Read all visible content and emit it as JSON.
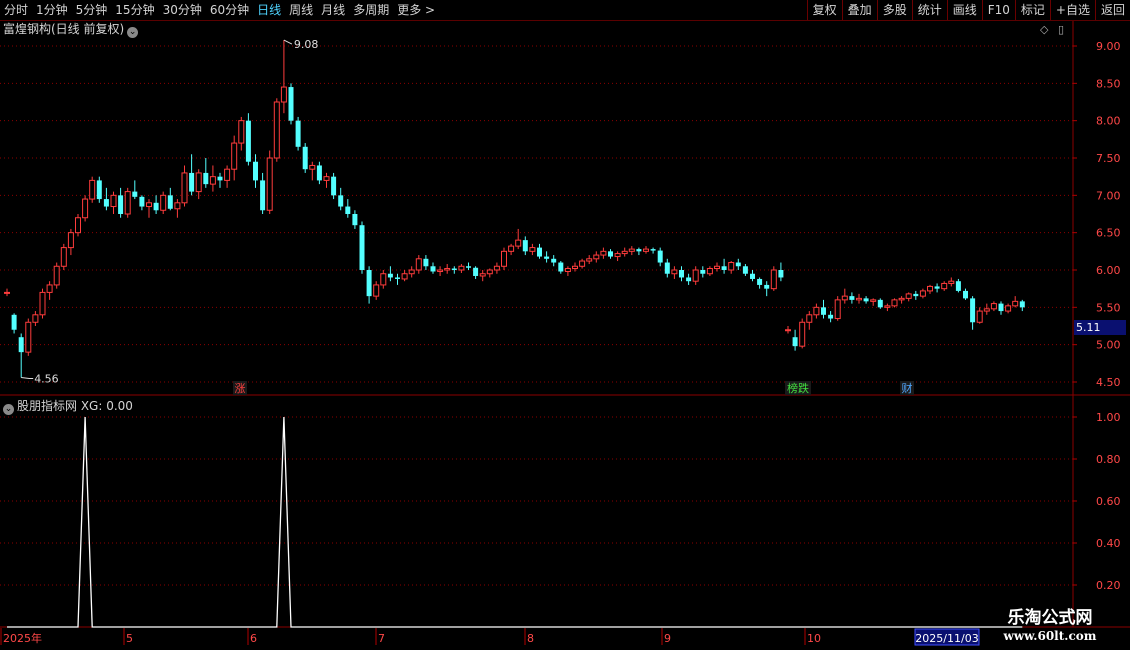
{
  "toolbar": {
    "periods": [
      "分时",
      "1分钟",
      "5分钟",
      "15分钟",
      "30分钟",
      "60分钟",
      "日线",
      "周线",
      "月线",
      "多周期",
      "更多 >"
    ],
    "active_period": "日线",
    "actions": [
      "复权",
      "叠加",
      "多股",
      "统计",
      "画线",
      "F10",
      "标记",
      "+自选",
      "返回"
    ]
  },
  "main": {
    "title": "富煌钢构(日线 前复权)",
    "high_label": "9.08",
    "low_label": "4.56",
    "current_price": "5.11",
    "y_ticks": [
      "9.00",
      "8.50",
      "8.00",
      "7.50",
      "7.00",
      "6.50",
      "6.00",
      "5.50",
      "5.00",
      "4.50"
    ],
    "markers": [
      {
        "text": "涨",
        "color": "#ff4040"
      },
      {
        "text": "榜跌",
        "color": "#40e040"
      },
      {
        "text": "财",
        "color": "#4fa8ff"
      }
    ]
  },
  "indicator": {
    "title": "股朋指标网 XG: 0.00",
    "y_ticks": [
      "1.00",
      "0.80",
      "0.60",
      "0.40",
      "0.20"
    ]
  },
  "x_axis": {
    "labels": [
      "2025年",
      "5",
      "6",
      "7",
      "8",
      "9",
      "10"
    ],
    "date_box": "2025/11/03"
  },
  "watermark": {
    "line1": "乐淘公式网",
    "line2": "www.60lt.com"
  },
  "colors": {
    "up": "#ff3c3c",
    "down": "#54ffff",
    "grid": "#8b0000",
    "line": "#ffffff"
  },
  "chart_data": [
    {
      "type": "candlestick",
      "title": "富煌钢构(日线 前复权)",
      "ylim": [
        4.4,
        9.2
      ],
      "high": 9.08,
      "low": 4.56,
      "last": 5.11,
      "ohlc": [
        [
          5.7,
          5.75,
          5.65,
          5.7
        ],
        [
          5.4,
          5.42,
          5.15,
          5.2
        ],
        [
          5.1,
          5.15,
          4.56,
          4.9
        ],
        [
          4.9,
          5.35,
          4.85,
          5.3
        ],
        [
          5.3,
          5.45,
          5.25,
          5.4
        ],
        [
          5.4,
          5.75,
          5.35,
          5.7
        ],
        [
          5.7,
          5.85,
          5.6,
          5.8
        ],
        [
          5.8,
          6.1,
          5.75,
          6.05
        ],
        [
          6.05,
          6.35,
          6.0,
          6.3
        ],
        [
          6.3,
          6.55,
          6.2,
          6.5
        ],
        [
          6.5,
          6.75,
          6.45,
          6.7
        ],
        [
          6.7,
          7.0,
          6.65,
          6.95
        ],
        [
          6.95,
          7.25,
          6.9,
          7.2
        ],
        [
          7.2,
          7.25,
          6.9,
          6.95
        ],
        [
          6.95,
          7.1,
          6.8,
          6.85
        ],
        [
          6.85,
          7.05,
          6.75,
          7.0
        ],
        [
          7.0,
          7.1,
          6.7,
          6.75
        ],
        [
          6.75,
          7.1,
          6.7,
          7.05
        ],
        [
          7.05,
          7.2,
          6.95,
          6.98
        ],
        [
          6.98,
          7.0,
          6.8,
          6.85
        ],
        [
          6.85,
          6.95,
          6.7,
          6.9
        ],
        [
          6.9,
          7.0,
          6.75,
          6.8
        ],
        [
          6.8,
          7.05,
          6.75,
          7.0
        ],
        [
          7.0,
          7.1,
          6.8,
          6.82
        ],
        [
          6.82,
          6.95,
          6.7,
          6.9
        ],
        [
          6.9,
          7.4,
          6.85,
          7.3
        ],
        [
          7.3,
          7.55,
          7.0,
          7.05
        ],
        [
          7.05,
          7.35,
          6.95,
          7.3
        ],
        [
          7.3,
          7.5,
          7.1,
          7.15
        ],
        [
          7.15,
          7.4,
          7.05,
          7.25
        ],
        [
          7.25,
          7.3,
          7.1,
          7.2
        ],
        [
          7.2,
          7.4,
          7.1,
          7.35
        ],
        [
          7.35,
          7.8,
          7.2,
          7.7
        ],
        [
          7.7,
          8.05,
          7.6,
          8.0
        ],
        [
          8.0,
          8.1,
          7.4,
          7.45
        ],
        [
          7.45,
          7.55,
          7.1,
          7.2
        ],
        [
          7.2,
          7.3,
          6.75,
          6.8
        ],
        [
          6.8,
          7.6,
          6.75,
          7.5
        ],
        [
          7.5,
          8.3,
          7.45,
          8.25
        ],
        [
          8.25,
          9.08,
          8.1,
          8.45
        ],
        [
          8.45,
          8.5,
          7.95,
          8.0
        ],
        [
          8.0,
          8.05,
          7.6,
          7.65
        ],
        [
          7.65,
          7.7,
          7.3,
          7.35
        ],
        [
          7.35,
          7.45,
          7.2,
          7.4
        ],
        [
          7.4,
          7.45,
          7.15,
          7.2
        ],
        [
          7.2,
          7.3,
          7.1,
          7.25
        ],
        [
          7.25,
          7.3,
          6.95,
          7.0
        ],
        [
          7.0,
          7.1,
          6.8,
          6.85
        ],
        [
          6.85,
          6.95,
          6.7,
          6.75
        ],
        [
          6.75,
          6.8,
          6.55,
          6.6
        ],
        [
          6.6,
          6.65,
          5.95,
          6.0
        ],
        [
          6.0,
          6.05,
          5.55,
          5.65
        ],
        [
          5.65,
          5.85,
          5.6,
          5.8
        ],
        [
          5.8,
          6.0,
          5.75,
          5.95
        ],
        [
          5.95,
          6.05,
          5.85,
          5.9
        ],
        [
          5.9,
          5.95,
          5.8,
          5.88
        ],
        [
          5.88,
          6.0,
          5.85,
          5.95
        ],
        [
          5.95,
          6.05,
          5.9,
          6.0
        ],
        [
          6.0,
          6.2,
          5.95,
          6.15
        ],
        [
          6.15,
          6.2,
          6.0,
          6.05
        ],
        [
          6.05,
          6.1,
          5.95,
          5.98
        ],
        [
          5.98,
          6.05,
          5.92,
          6.0
        ],
        [
          6.0,
          6.08,
          5.95,
          6.02
        ],
        [
          6.02,
          6.05,
          5.95,
          6.0
        ],
        [
          6.0,
          6.08,
          5.96,
          6.05
        ],
        [
          6.05,
          6.1,
          6.0,
          6.03
        ],
        [
          6.03,
          6.05,
          5.88,
          5.92
        ],
        [
          5.92,
          6.0,
          5.85,
          5.95
        ],
        [
          5.95,
          6.02,
          5.9,
          6.0
        ],
        [
          6.0,
          6.1,
          5.95,
          6.05
        ],
        [
          6.05,
          6.3,
          6.0,
          6.25
        ],
        [
          6.25,
          6.35,
          6.2,
          6.32
        ],
        [
          6.32,
          6.55,
          6.28,
          6.4
        ],
        [
          6.4,
          6.45,
          6.2,
          6.25
        ],
        [
          6.25,
          6.35,
          6.2,
          6.3
        ],
        [
          6.3,
          6.35,
          6.15,
          6.18
        ],
        [
          6.18,
          6.25,
          6.1,
          6.15
        ],
        [
          6.15,
          6.2,
          6.05,
          6.1
        ],
        [
          6.1,
          6.12,
          5.95,
          5.98
        ],
        [
          5.98,
          6.05,
          5.92,
          6.02
        ],
        [
          6.02,
          6.1,
          5.98,
          6.05
        ],
        [
          6.05,
          6.15,
          6.02,
          6.12
        ],
        [
          6.12,
          6.2,
          6.08,
          6.15
        ],
        [
          6.15,
          6.25,
          6.1,
          6.2
        ],
        [
          6.2,
          6.3,
          6.15,
          6.25
        ],
        [
          6.25,
          6.28,
          6.15,
          6.18
        ],
        [
          6.18,
          6.25,
          6.12,
          6.22
        ],
        [
          6.22,
          6.3,
          6.18,
          6.25
        ],
        [
          6.25,
          6.32,
          6.2,
          6.28
        ],
        [
          6.28,
          6.3,
          6.2,
          6.25
        ],
        [
          6.25,
          6.32,
          6.22,
          6.28
        ],
        [
          6.28,
          6.3,
          6.22,
          6.26
        ],
        [
          6.26,
          6.3,
          6.05,
          6.1
        ],
        [
          6.1,
          6.15,
          5.9,
          5.95
        ],
        [
          5.95,
          6.05,
          5.88,
          6.0
        ],
        [
          6.0,
          6.05,
          5.85,
          5.9
        ],
        [
          5.9,
          5.95,
          5.8,
          5.85
        ],
        [
          5.85,
          6.05,
          5.8,
          6.0
        ],
        [
          6.0,
          6.05,
          5.9,
          5.95
        ],
        [
          5.95,
          6.05,
          5.92,
          6.02
        ],
        [
          6.02,
          6.1,
          5.98,
          6.05
        ],
        [
          6.05,
          6.15,
          5.95,
          6.0
        ],
        [
          6.0,
          6.12,
          5.95,
          6.1
        ],
        [
          6.1,
          6.15,
          6.0,
          6.05
        ],
        [
          6.05,
          6.08,
          5.92,
          5.95
        ],
        [
          5.95,
          6.0,
          5.85,
          5.88
        ],
        [
          5.88,
          5.9,
          5.75,
          5.8
        ],
        [
          5.8,
          5.85,
          5.65,
          5.75
        ],
        [
          5.75,
          6.05,
          5.72,
          6.0
        ],
        [
          6.0,
          6.1,
          5.85,
          5.9
        ],
        [
          5.2,
          5.25,
          5.15,
          5.2
        ],
        [
          5.1,
          5.2,
          4.92,
          4.98
        ],
        [
          4.98,
          5.35,
          4.95,
          5.3
        ],
        [
          5.3,
          5.45,
          5.2,
          5.4
        ],
        [
          5.4,
          5.55,
          5.35,
          5.5
        ],
        [
          5.5,
          5.6,
          5.35,
          5.4
        ],
        [
          5.4,
          5.45,
          5.3,
          5.35
        ],
        [
          5.35,
          5.65,
          5.32,
          5.6
        ],
        [
          5.6,
          5.75,
          5.55,
          5.65
        ],
        [
          5.65,
          5.7,
          5.55,
          5.6
        ],
        [
          5.6,
          5.68,
          5.55,
          5.62
        ],
        [
          5.62,
          5.65,
          5.55,
          5.58
        ],
        [
          5.58,
          5.62,
          5.52,
          5.6
        ],
        [
          5.6,
          5.62,
          5.48,
          5.5
        ],
        [
          5.5,
          5.55,
          5.45,
          5.52
        ],
        [
          5.52,
          5.62,
          5.5,
          5.6
        ],
        [
          5.6,
          5.65,
          5.55,
          5.62
        ],
        [
          5.62,
          5.7,
          5.58,
          5.68
        ],
        [
          5.68,
          5.72,
          5.6,
          5.65
        ],
        [
          5.65,
          5.75,
          5.62,
          5.72
        ],
        [
          5.72,
          5.8,
          5.68,
          5.78
        ],
        [
          5.78,
          5.82,
          5.7,
          5.75
        ],
        [
          5.75,
          5.85,
          5.72,
          5.82
        ],
        [
          5.82,
          5.9,
          5.78,
          5.85
        ],
        [
          5.85,
          5.88,
          5.7,
          5.72
        ],
        [
          5.72,
          5.75,
          5.6,
          5.62
        ],
        [
          5.62,
          5.65,
          5.2,
          5.3
        ],
        [
          5.3,
          5.5,
          5.28,
          5.45
        ],
        [
          5.45,
          5.55,
          5.4,
          5.48
        ],
        [
          5.48,
          5.58,
          5.45,
          5.55
        ],
        [
          5.55,
          5.58,
          5.4,
          5.45
        ],
        [
          5.45,
          5.55,
          5.42,
          5.52
        ],
        [
          5.52,
          5.65,
          5.5,
          5.58
        ],
        [
          5.58,
          5.6,
          5.45,
          5.5
        ]
      ]
    },
    {
      "type": "line",
      "title": "股朋指标网 XG: 0.00",
      "ylim": [
        0,
        1.05
      ],
      "spikes_at_bar": [
        11,
        39
      ],
      "values_note": "0 everywhere, 1.00 at spike bars"
    }
  ]
}
